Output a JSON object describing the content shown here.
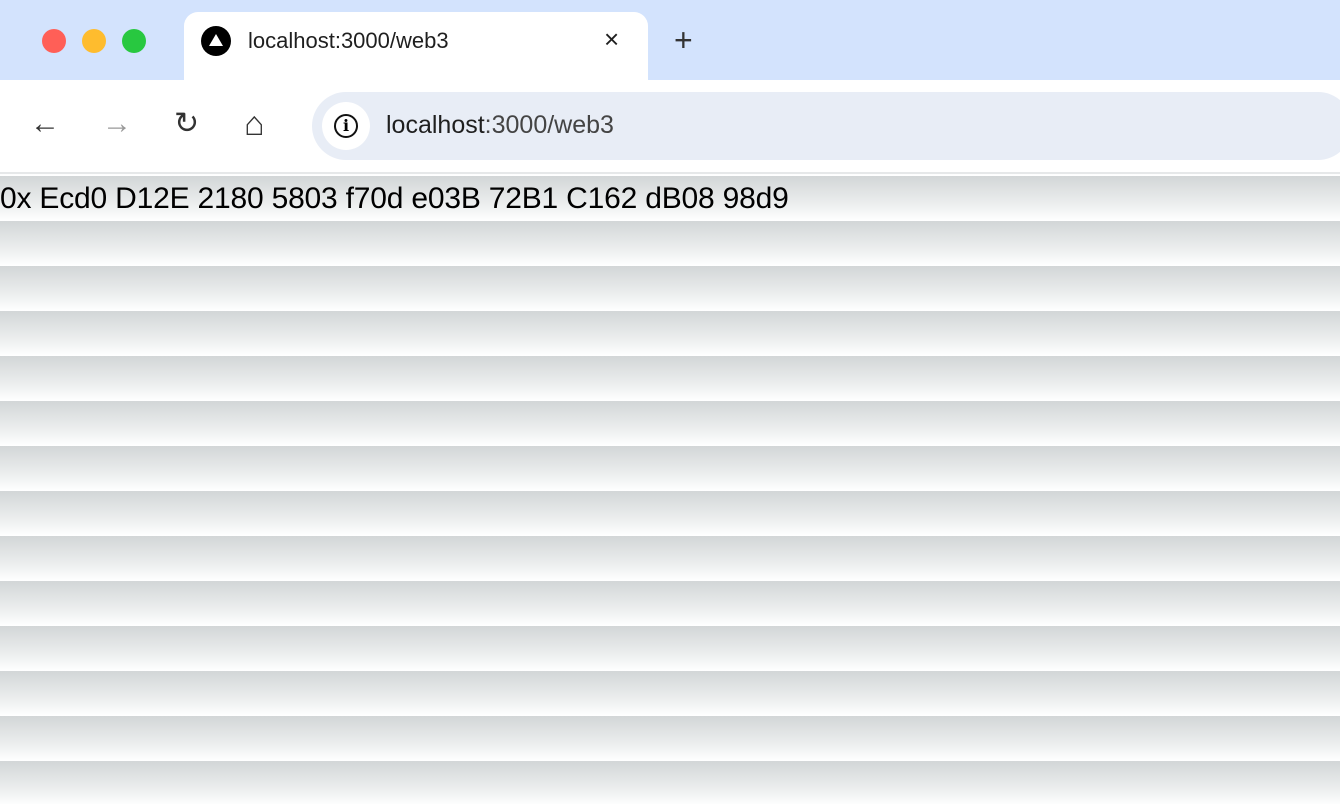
{
  "browser": {
    "tab": {
      "title": "localhost:3000/web3",
      "close": "×"
    },
    "new_tab": "+",
    "nav": {
      "back": "←",
      "forward": "→",
      "reload": "↻",
      "home": "⌂"
    },
    "address": {
      "host": "localhost",
      "rest": ":3000/web3"
    },
    "colors": {
      "close": "#ff5f57",
      "minimize": "#febc2e",
      "maximize": "#28c840"
    }
  },
  "page": {
    "wallet_address": "0x Ecd0 D12E 2180 5803 f70d e03B 72B1 C162 dB08 98d9"
  }
}
